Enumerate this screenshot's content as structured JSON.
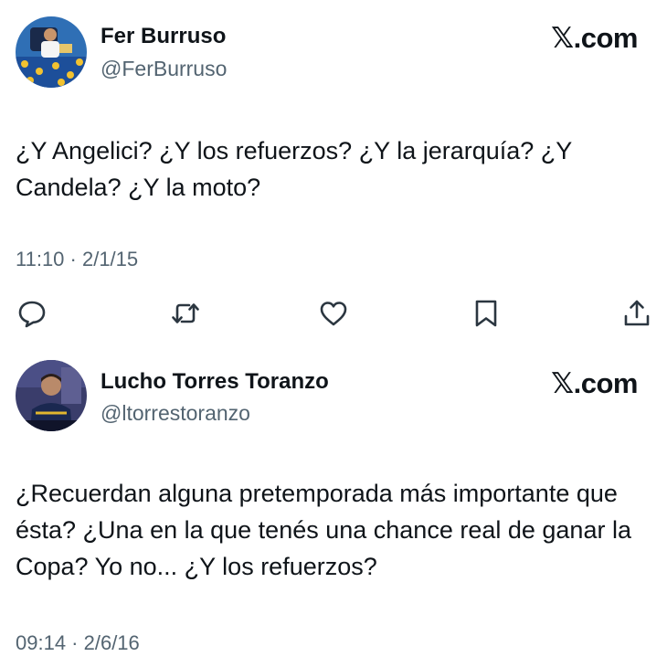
{
  "tweets": [
    {
      "display_name": "Fer Burruso",
      "handle": "@FerBurruso",
      "brand": "𝕏.com",
      "text": "¿Y Angelici? ¿Y los refuerzos? ¿Y la jerarquía? ¿Y Candela? ¿Y la moto?",
      "timestamp": "11:10 · 2/1/15",
      "actions": [
        {
          "icon": "reply-icon"
        },
        {
          "icon": "retweet-icon"
        },
        {
          "icon": "like-icon"
        },
        {
          "icon": "bookmark-icon"
        },
        {
          "icon": "share-icon"
        }
      ]
    },
    {
      "display_name": "Lucho Torres Toranzo",
      "handle": "@ltorrestoranzo",
      "brand": "𝕏.com",
      "text": "¿Recuerdan alguna pretemporada más importante que ésta? ¿Una en la que tenés una chance real de ganar la Copa? Yo no... ¿Y los refuerzos?",
      "timestamp": "09:14 · 2/6/16"
    }
  ],
  "colors": {
    "text": "#0f1419",
    "secondary": "#536471",
    "background": "#ffffff"
  }
}
